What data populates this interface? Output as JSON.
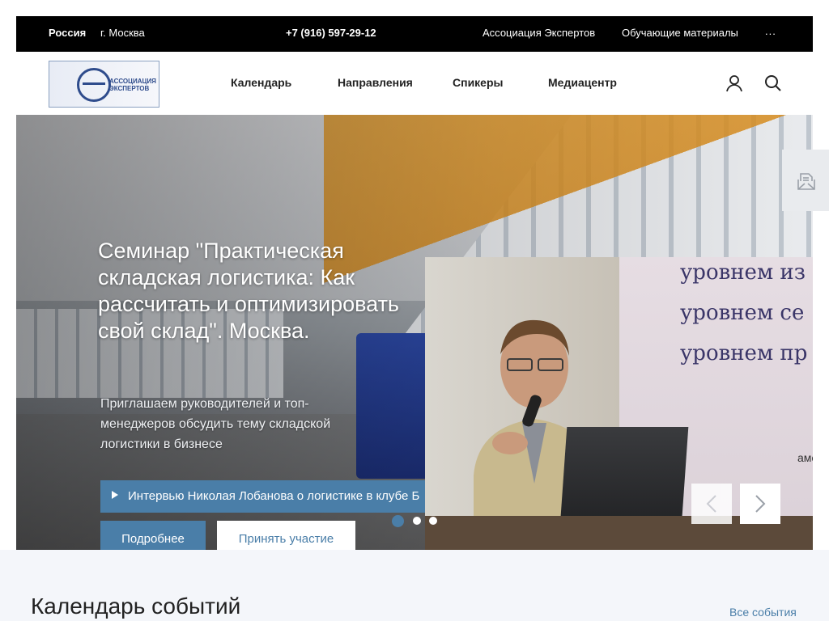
{
  "topbar": {
    "country": "Россия",
    "city": "г. Москва",
    "phone": "+7 (916) 597-29-12",
    "links": [
      "Ассоциация Экспертов",
      "Обучающие материалы"
    ],
    "more": "..."
  },
  "logo": {
    "name_line1": "АССОЦИАЦИЯ",
    "name_line2": "ЭКСПЕРТОВ"
  },
  "nav": [
    "Календарь",
    "Направления",
    "Спикеры",
    "Медиацентр"
  ],
  "hero": {
    "title": "Семинар \"Практическая складская логистика: Как рассчитать и оптимизировать свой склад\". Москва.",
    "description": "Приглашаем руководителей и топ-менеджеров обсудить тему складской логистики  в бизнесе",
    "video_link": "Интервью Николая Лобанова о логистике в клубе Б",
    "btn_more": "Подробнее",
    "btn_join": "Принять участие",
    "active_slide": 1,
    "slide_count": 3
  },
  "slide_screen": {
    "line1": "уровнем из",
    "line2": "уровнем се",
    "line3": "уровнем пр",
    "line4": "аметки к слайду"
  },
  "calendar": {
    "title": "Календарь событий",
    "all_link": "Все события"
  },
  "colors": {
    "accent": "#4a7ea8",
    "topbar": "#000000",
    "section_bg": "#f4f6fa"
  }
}
